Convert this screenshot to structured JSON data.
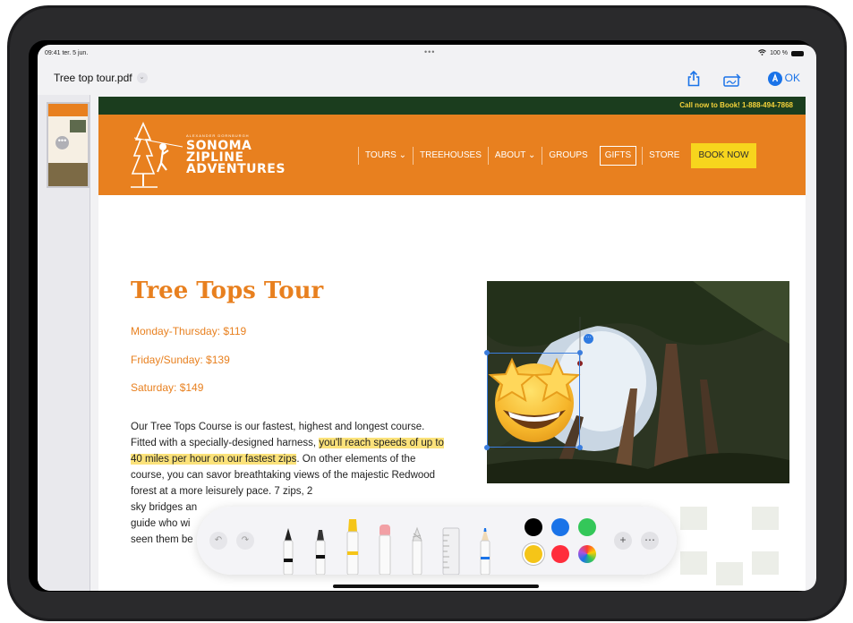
{
  "status_bar": {
    "time": "09:41 ter. 5 jun.",
    "dots": "•••",
    "battery": "100 %"
  },
  "toolbar": {
    "title": "Tree top tour.pdf",
    "ok_label": "OK"
  },
  "thumbnail": {
    "more": "•••"
  },
  "site": {
    "call_banner": "Call now to Book! 1-888-494-7868",
    "logo_small": "ALEXANDER DORNBURGH",
    "logo_lines": [
      "SONOMA",
      "ZIPLINE",
      "ADVENTURES"
    ],
    "nav": {
      "tours": "TOURS",
      "treehouses": "TREEHOUSES",
      "about": "ABOUT",
      "groups": "GROUPS",
      "gifts": "GIFTS",
      "store": "STORE",
      "book_now": "BOOK NOW"
    }
  },
  "tour": {
    "title": "Tree Tops Tour",
    "prices": [
      "Monday-Thursday: $119",
      "Friday/Sunday: $139",
      "Saturday: $149"
    ],
    "body_before": "Our Tree Tops Course is our fastest, highest and longest course. Fitted with a specially-designed harness, ",
    "body_highlight": "you'll reach speeds of up to 40 miles per hour on our fastest zips",
    "body_after": ". On other elements of the course, you can savor breathtaking views of the majestic Redwood forest at a more leisurely pace. 7 zips, 2",
    "body_line_a": "sky bridges an",
    "body_line_b": "guide who wi",
    "body_line_c": "seen them be"
  },
  "sticker": {
    "name": "star-struck emoji"
  },
  "markup_tools": [
    "pen",
    "marker",
    "highlighter",
    "eraser",
    "lasso",
    "ruler",
    "pencil"
  ],
  "colors": {
    "accent": "#1a73e8",
    "brand_orange": "#e8801f",
    "brand_green": "#1b3d1e",
    "palette": [
      "#000000",
      "#1a73e8",
      "#34c759",
      "#f5c518",
      "#ff2d3c",
      "multicolor"
    ]
  }
}
